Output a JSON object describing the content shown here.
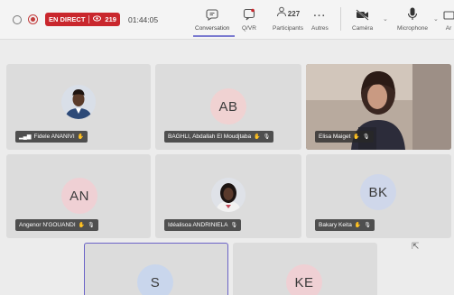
{
  "toolbar": {
    "live_label": "EN DIRECT",
    "viewer_count": "219",
    "timer": "01:44:05",
    "conversation_label": "Conversation",
    "qr_label": "Q/VR",
    "participants_count": "227",
    "participants_label": "Participants",
    "others_label": "Autres",
    "camera_label": "Caméra",
    "microphone_label": "Microphone",
    "overflow_label": "Ar",
    "colors": {
      "live_badge": "#c9272d",
      "active_tab": "#7a7ad0"
    }
  },
  "participants": [
    {
      "name": "Fidele ANANIVI",
      "type": "photo"
    },
    {
      "name": "BAGHLI, Abdallah El Moudjtaba",
      "initials": "AB",
      "avatar_color": "#f0d2d2"
    },
    {
      "name": "Elisa Maiget",
      "type": "video"
    },
    {
      "name": "Angenor N'GOUANDI",
      "initials": "AN",
      "avatar_color": "#efd0d4"
    },
    {
      "name": "Idéalisoa ANDRINIELA",
      "type": "photo"
    },
    {
      "name": "Bakary Keita",
      "initials": "BK",
      "avatar_color": "#cfd7ea"
    },
    {
      "initials": "S",
      "avatar_color": "#c9d6ec"
    },
    {
      "initials": "KE",
      "avatar_color": "#efd0d4"
    }
  ]
}
